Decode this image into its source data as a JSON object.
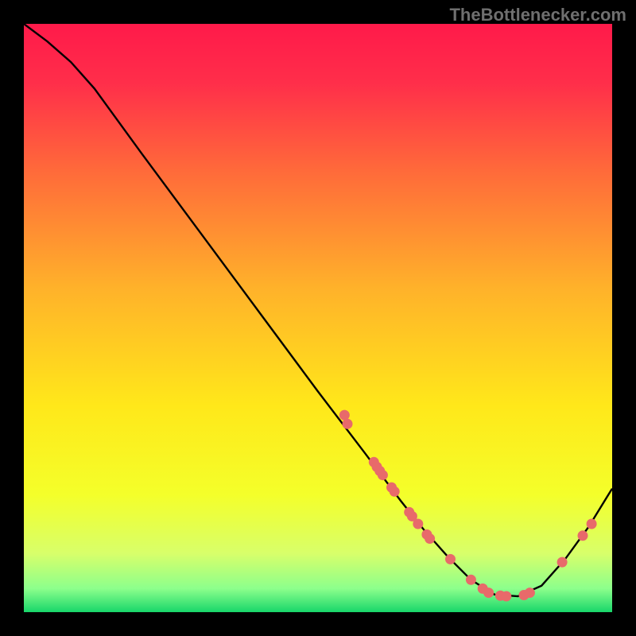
{
  "attribution": "TheBottlenecker.com",
  "chart_data": {
    "type": "line",
    "title": "",
    "xlabel": "",
    "ylabel": "",
    "xlim": [
      0,
      100
    ],
    "ylim": [
      0,
      100
    ],
    "background_gradient": {
      "stops": [
        {
          "offset": 0.0,
          "color": "#ff1a4a"
        },
        {
          "offset": 0.1,
          "color": "#ff2e4a"
        },
        {
          "offset": 0.25,
          "color": "#ff6a3a"
        },
        {
          "offset": 0.45,
          "color": "#ffb22a"
        },
        {
          "offset": 0.65,
          "color": "#ffe81a"
        },
        {
          "offset": 0.8,
          "color": "#f4ff2a"
        },
        {
          "offset": 0.9,
          "color": "#d8ff6a"
        },
        {
          "offset": 0.96,
          "color": "#8cff8c"
        },
        {
          "offset": 1.0,
          "color": "#18d66a"
        }
      ]
    },
    "series": [
      {
        "name": "curve",
        "color": "#000000",
        "x": [
          0,
          4,
          8,
          12,
          20,
          30,
          40,
          50,
          58,
          64,
          68,
          72,
          76,
          80,
          84,
          88,
          92,
          96,
          100
        ],
        "y": [
          100,
          97,
          93.5,
          89,
          78,
          64.5,
          51,
          37.5,
          27,
          19,
          14,
          9.5,
          5.5,
          3,
          2.7,
          4.5,
          9,
          14.5,
          21
        ]
      }
    ],
    "scatter": [
      {
        "name": "markers",
        "color": "#e86a6a",
        "points": [
          {
            "x": 54.5,
            "y": 33.5
          },
          {
            "x": 55.0,
            "y": 32.0
          },
          {
            "x": 59.5,
            "y": 25.5
          },
          {
            "x": 60.0,
            "y": 24.7
          },
          {
            "x": 60.5,
            "y": 24.0
          },
          {
            "x": 61.0,
            "y": 23.3
          },
          {
            "x": 62.5,
            "y": 21.2
          },
          {
            "x": 63.0,
            "y": 20.5
          },
          {
            "x": 65.5,
            "y": 17.0
          },
          {
            "x": 66.0,
            "y": 16.3
          },
          {
            "x": 67.0,
            "y": 15.0
          },
          {
            "x": 68.5,
            "y": 13.2
          },
          {
            "x": 69.0,
            "y": 12.5
          },
          {
            "x": 72.5,
            "y": 9.0
          },
          {
            "x": 76.0,
            "y": 5.5
          },
          {
            "x": 78.0,
            "y": 4.0
          },
          {
            "x": 79.0,
            "y": 3.3
          },
          {
            "x": 81.0,
            "y": 2.8
          },
          {
            "x": 82.0,
            "y": 2.7
          },
          {
            "x": 85.0,
            "y": 2.9
          },
          {
            "x": 86.0,
            "y": 3.3
          },
          {
            "x": 91.5,
            "y": 8.5
          },
          {
            "x": 95.0,
            "y": 13.0
          },
          {
            "x": 96.5,
            "y": 15.0
          }
        ]
      }
    ]
  }
}
